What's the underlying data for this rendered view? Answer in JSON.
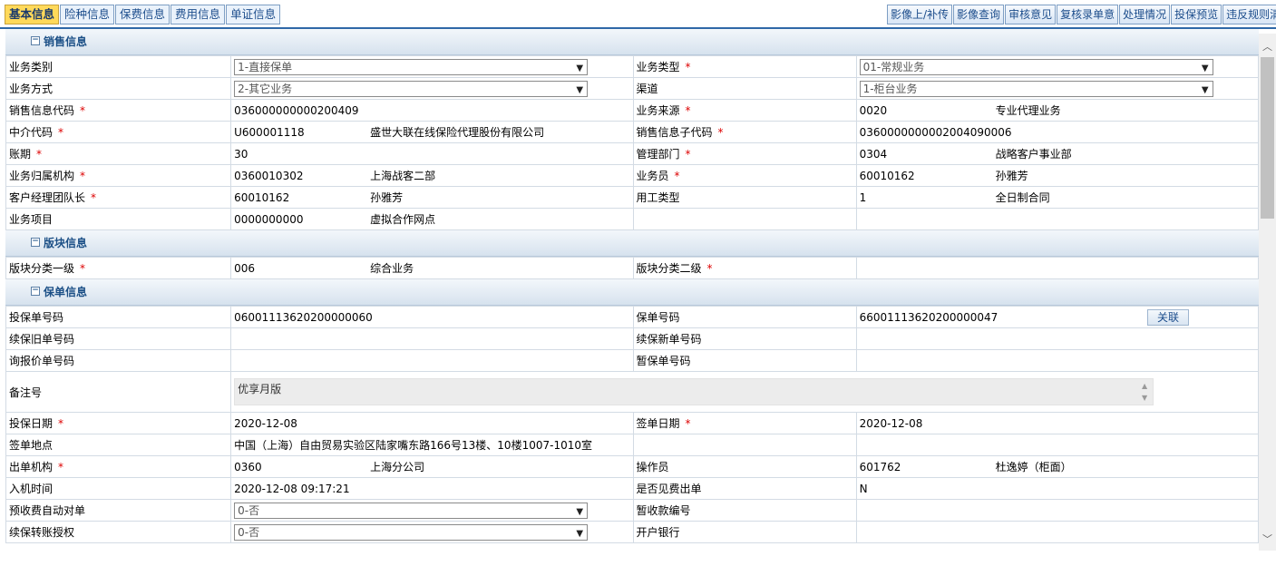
{
  "tabs": [
    "基本信息",
    "险种信息",
    "保费信息",
    "费用信息",
    "单证信息"
  ],
  "actions": [
    "影像上/补传",
    "影像查询",
    "审核意见",
    "复核录单意",
    "处理情况",
    "投保预览",
    "违反规则清"
  ],
  "sections": {
    "sales": "销售信息",
    "segment": "版块信息",
    "policy": "保单信息"
  },
  "sales": {
    "biz_category": {
      "label": "业务类别",
      "value": "1-直接保单"
    },
    "biz_type": {
      "label": "业务类型",
      "value": "01-常规业务"
    },
    "biz_mode": {
      "label": "业务方式",
      "value": "2-其它业务"
    },
    "channel": {
      "label": "渠道",
      "value": "1-柜台业务"
    },
    "sales_code": {
      "label": "销售信息代码",
      "value": "036000000000200409"
    },
    "biz_source": {
      "label": "业务来源",
      "code": "0020",
      "name": "专业代理业务"
    },
    "agent_code": {
      "label": "中介代码",
      "code": "U600001118",
      "name": "盛世大联在线保险代理股份有限公司"
    },
    "sales_sub_code": {
      "label": "销售信息子代码",
      "value": "0360000000002004090006"
    },
    "period": {
      "label": "账期",
      "value": "30"
    },
    "mgmt_dept": {
      "label": "管理部门",
      "code": "0304",
      "name": "战略客户事业部"
    },
    "biz_org": {
      "label": "业务归属机构",
      "code": "0360010302",
      "name": "上海战客二部"
    },
    "salesman": {
      "label": "业务员",
      "code": "60010162",
      "name": "孙雅芳"
    },
    "team_leader": {
      "label": "客户经理团队长",
      "code": "60010162",
      "name": "孙雅芳"
    },
    "employ_type": {
      "label": "用工类型",
      "code": "1",
      "name": "全日制合同"
    },
    "biz_project": {
      "label": "业务项目",
      "code": "0000000000",
      "name": "虚拟合作网点"
    }
  },
  "segment": {
    "level1": {
      "label": "版块分类一级",
      "code": "006",
      "name": "综合业务"
    },
    "level2": {
      "label": "版块分类二级",
      "value": ""
    }
  },
  "policy": {
    "proposal_no": {
      "label": "投保单号码",
      "value": "06001113620200000060"
    },
    "policy_no": {
      "label": "保单号码",
      "value": "66001113620200000047"
    },
    "link_btn": "关联",
    "renew_old": {
      "label": "续保旧单号码",
      "value": ""
    },
    "renew_new": {
      "label": "续保新单号码",
      "value": ""
    },
    "quote_no": {
      "label": "询报价单号码",
      "value": ""
    },
    "temp_no": {
      "label": "暂保单号码",
      "value": ""
    },
    "remark": {
      "label": "备注号",
      "value": "优享月版"
    },
    "apply_date": {
      "label": "投保日期",
      "value": "2020-12-08"
    },
    "sign_date": {
      "label": "签单日期",
      "value": "2020-12-08"
    },
    "sign_place": {
      "label": "签单地点",
      "value": "中国（上海）自由贸易实验区陆家嘴东路166号13楼、10楼1007-1010室"
    },
    "issue_org": {
      "label": "出单机构",
      "code": "0360",
      "name": "上海分公司"
    },
    "operator": {
      "label": "操作员",
      "code": "601762",
      "name": "杜逸婷（柜面）"
    },
    "entry_time": {
      "label": "入机时间",
      "value": "2020-12-08 09:17:21"
    },
    "fee_before": {
      "label": "是否见费出单",
      "value": "N"
    },
    "prepay_auto": {
      "label": "预收费自动对单",
      "value": "0-否"
    },
    "temp_receipt": {
      "label": "暂收款编号",
      "value": ""
    },
    "renew_auth": {
      "label": "续保转账授权",
      "value": "0-否"
    },
    "bank": {
      "label": "开户银行",
      "value": ""
    }
  }
}
